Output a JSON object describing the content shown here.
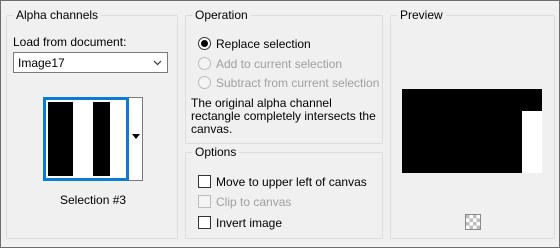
{
  "alpha": {
    "title": "Alpha channels",
    "load_label": "Load from document:",
    "document_value": "Image17",
    "selection_label": "Selection #3"
  },
  "operation": {
    "title": "Operation",
    "replace": "Replace selection",
    "add": "Add to current selection",
    "subtract": "Subtract from current selection",
    "description": "The original alpha channel rectangle completely intersects the canvas."
  },
  "options": {
    "title": "Options",
    "move": "Move to upper left of canvas",
    "clip": "Clip to canvas",
    "invert": "Invert image"
  },
  "preview": {
    "title": "Preview"
  },
  "colors": {
    "accent": "#0a7bd6",
    "disabled_text": "#a0a0a0"
  }
}
